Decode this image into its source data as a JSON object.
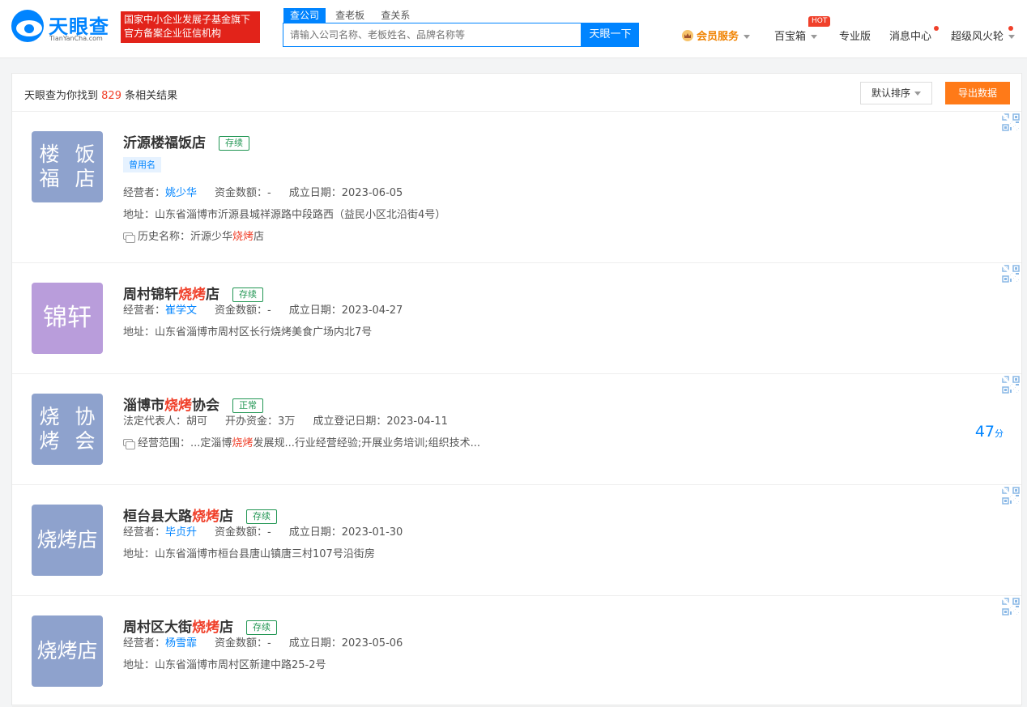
{
  "header": {
    "logo_text": "天眼查",
    "logo_sub": "TianYanCha.com",
    "badge_line1": "国家中小企业发展子基金旗下",
    "badge_line2": "官方备案企业征信机构",
    "search_tabs": [
      "查公司",
      "查老板",
      "查关系"
    ],
    "search_placeholder": "请输入公司名称、老板姓名、品牌名称等",
    "search_button": "天眼一下",
    "nav": {
      "vip": "会员服务",
      "treasure": "百宝箱",
      "hot_badge": "HOT",
      "pro": "专业版",
      "messages": "消息中心",
      "user": "超级风火轮"
    }
  },
  "results": {
    "found_prefix": "天眼查为你找到",
    "found_count": "829",
    "found_suffix": "条相关结果",
    "sort_label": "默认排序",
    "export_label": "导出数据"
  },
  "colors": {
    "brand": "#0084ff",
    "highlight": "#f0402a",
    "status_green": "#219653",
    "export_orange": "#ff7a18"
  },
  "companies": [
    {
      "avatar_lines": [
        "楼福",
        "饭店"
      ],
      "avatar_color": "#8ea2cd",
      "name_parts": [
        {
          "t": "沂源楼福饭店",
          "h": false
        }
      ],
      "status": "存续",
      "tag": "曾用名",
      "info": [
        {
          "label": "经营者：",
          "value": "姚少华",
          "link": true
        },
        {
          "label": "资金数额：",
          "value": "-",
          "link": false
        },
        {
          "label": "成立日期：",
          "value": "2023-06-05",
          "link": false
        }
      ],
      "address_label": "地址：",
      "address": "山东省淄博市沂源县城祥源路中段路西（益民小区北沿街4号）",
      "extra_label": "历史名称：",
      "extra_parts": [
        {
          "t": "沂源少华",
          "h": false
        },
        {
          "t": "烧烤",
          "h": true
        },
        {
          "t": "店",
          "h": false
        }
      ]
    },
    {
      "avatar_lines": [
        "锦轩"
      ],
      "avatar_color": "#b99ddb",
      "name_parts": [
        {
          "t": "周村锦轩",
          "h": false
        },
        {
          "t": "烧烤",
          "h": true
        },
        {
          "t": "店",
          "h": false
        }
      ],
      "status": "存续",
      "info": [
        {
          "label": "经营者：",
          "value": "崔学文",
          "link": true
        },
        {
          "label": "资金数额：",
          "value": "-",
          "link": false
        },
        {
          "label": "成立日期：",
          "value": "2023-04-27",
          "link": false
        }
      ],
      "address_label": "地址：",
      "address": "山东省淄博市周村区长行烧烤美食广场内北7号"
    },
    {
      "avatar_lines": [
        "烧烤",
        "协会"
      ],
      "avatar_color": "#8ea2cd",
      "name_parts": [
        {
          "t": "淄博市",
          "h": false
        },
        {
          "t": "烧烤",
          "h": true
        },
        {
          "t": "协会",
          "h": false
        }
      ],
      "status": "正常",
      "info": [
        {
          "label": "法定代表人：",
          "value": "胡可",
          "link": false
        },
        {
          "label": "开办资金：",
          "value": "3万",
          "link": false
        },
        {
          "label": "成立登记日期：",
          "value": "2023-04-11",
          "link": false
        }
      ],
      "extra_label": "经营范围：",
      "extra_parts": [
        {
          "t": "...定淄博",
          "h": false
        },
        {
          "t": "烧烤",
          "h": true
        },
        {
          "t": "发展规...行业经营经验;开展业务培训;组织技术...",
          "h": false
        }
      ],
      "score": "47",
      "score_unit": "分"
    },
    {
      "avatar_lines": [
        "烧烤店"
      ],
      "avatar_color": "#8ea2cd",
      "name_parts": [
        {
          "t": "桓台县大路",
          "h": false
        },
        {
          "t": "烧烤",
          "h": true
        },
        {
          "t": "店",
          "h": false
        }
      ],
      "status": "存续",
      "info": [
        {
          "label": "经营者：",
          "value": "毕贞升",
          "link": true
        },
        {
          "label": "资金数额：",
          "value": "-",
          "link": false
        },
        {
          "label": "成立日期：",
          "value": "2023-01-30",
          "link": false
        }
      ],
      "address_label": "地址：",
      "address": "山东省淄博市桓台县唐山镇唐三村107号沿街房"
    },
    {
      "avatar_lines": [
        "烧烤店"
      ],
      "avatar_color": "#8ea2cd",
      "name_parts": [
        {
          "t": "周村区大街",
          "h": false
        },
        {
          "t": "烧烤",
          "h": true
        },
        {
          "t": "店",
          "h": false
        }
      ],
      "status": "存续",
      "info": [
        {
          "label": "经营者：",
          "value": "杨雪霏",
          "link": true
        },
        {
          "label": "资金数额：",
          "value": "-",
          "link": false
        },
        {
          "label": "成立日期：",
          "value": "2023-05-06",
          "link": false
        }
      ],
      "address_label": "地址：",
      "address": "山东省淄博市周村区新建中路25-2号"
    }
  ]
}
